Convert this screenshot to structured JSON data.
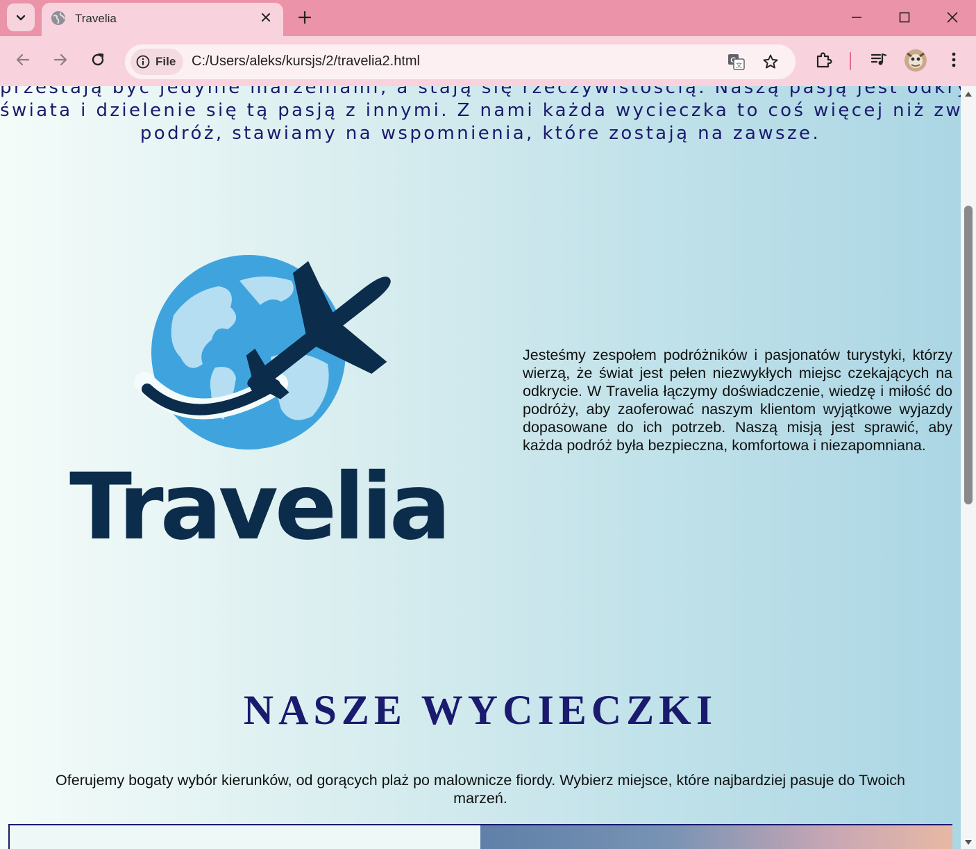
{
  "browser": {
    "tab": {
      "title": "Travelia"
    },
    "address": {
      "chip_label": "File",
      "url": "C:/Users/aleks/kursjs/2/travelia2.html"
    },
    "icons": [
      "chevron-down-icon",
      "globe-icon",
      "close-icon",
      "plus-icon",
      "minimize-icon",
      "maximize-icon",
      "close-window-icon",
      "back-icon",
      "forward-icon",
      "reload-icon",
      "info-icon",
      "translate-icon",
      "star-icon",
      "extensions-icon",
      "media-icon",
      "more-icon"
    ]
  },
  "page": {
    "intro_lines": [
      "przestają być jedynie marzeniami, a stają się rzeczywistością. Naszą pasją jest odkrywanie",
      "świata i dzielenie się tą pasją z innymi. Z nami każda wycieczka to coś więcej niż zwykła",
      "podróż, stawiamy na wspomnienia, które zostają na zawsze."
    ],
    "logo_text": "Travelia",
    "about": "Jesteśmy zespołem podróżników i pasjonatów turystyki, którzy wierzą, że świat jest pełen niezwykłych miejsc czekających na odkrycie. W Travelia łączymy doświadczenie, wiedzę i miłość do podróży, aby zaoferować naszym klientom wyjątkowe wyjazdy dopasowane do ich potrzeb. Naszą misją jest sprawić, aby każda podróż była bezpieczna, komfortowa i niezapomniana.",
    "trips_title": "NASZE WYCIECZKI",
    "trips_desc": "Oferujemy bogaty wybór kierunków, od gorących plaż po malownicze fiordy. Wybierz miejsce, które najbardziej pasuje do Twoich marzeń."
  },
  "colors": {
    "tabstrip": "#eb93a8",
    "toolbar": "#f8d3dd",
    "heading": "#1a1a6e",
    "logo_dark": "#0b2c4a",
    "globe": "#3fa4dd"
  }
}
